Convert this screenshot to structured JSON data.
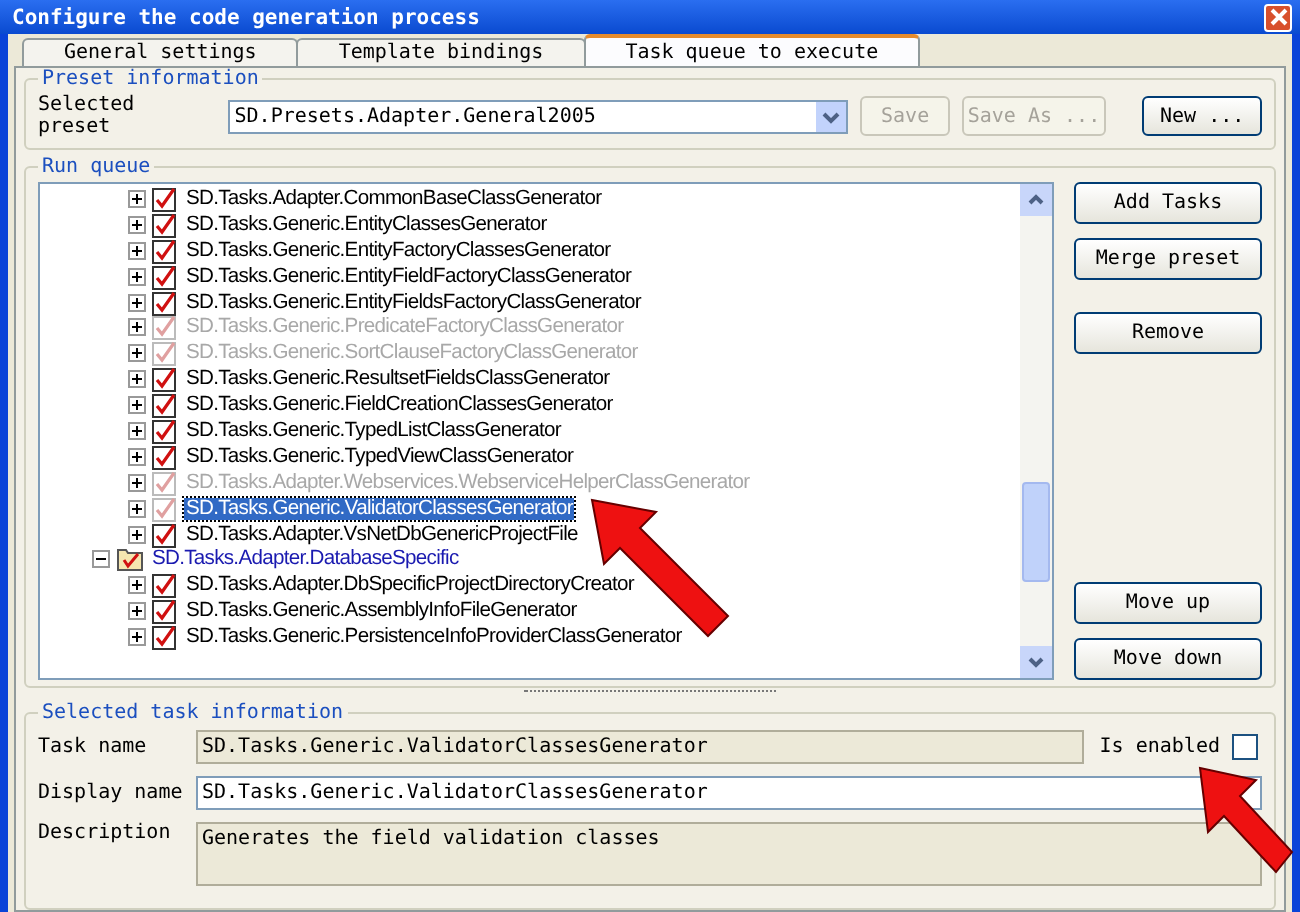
{
  "window": {
    "title": "Configure the code generation process"
  },
  "tabs": [
    {
      "label": "General settings",
      "selected": false
    },
    {
      "label": "Template bindings",
      "selected": false
    },
    {
      "label": "Task queue to execute",
      "selected": true
    }
  ],
  "preset": {
    "legend": "Preset information",
    "label": "Selected preset",
    "value": "SD.Presets.Adapter.General2005",
    "buttons": [
      {
        "label": "Save",
        "disabled": true
      },
      {
        "label": "Save As ...",
        "disabled": true
      },
      {
        "label": "New ...",
        "disabled": false
      }
    ]
  },
  "run_queue": {
    "legend": "Run queue",
    "tree": [
      {
        "kind": "task",
        "label": "SD.Tasks.Adapter.CommonBaseClassGenerator",
        "enabled": true,
        "selected": false
      },
      {
        "kind": "task",
        "label": "SD.Tasks.Generic.EntityClassesGenerator",
        "enabled": true,
        "selected": false
      },
      {
        "kind": "task",
        "label": "SD.Tasks.Generic.EntityFactoryClassesGenerator",
        "enabled": true,
        "selected": false
      },
      {
        "kind": "task",
        "label": "SD.Tasks.Generic.EntityFieldFactoryClassGenerator",
        "enabled": true,
        "selected": false
      },
      {
        "kind": "task",
        "label": "SD.Tasks.Generic.EntityFieldsFactoryClassGenerator",
        "enabled": true,
        "selected": false
      },
      {
        "kind": "task",
        "label": "SD.Tasks.Generic.PredicateFactoryClassGenerator",
        "enabled": false,
        "selected": false
      },
      {
        "kind": "task",
        "label": "SD.Tasks.Generic.SortClauseFactoryClassGenerator",
        "enabled": false,
        "selected": false
      },
      {
        "kind": "task",
        "label": "SD.Tasks.Generic.ResultsetFieldsClassGenerator",
        "enabled": true,
        "selected": false
      },
      {
        "kind": "task",
        "label": "SD.Tasks.Generic.FieldCreationClassesGenerator",
        "enabled": true,
        "selected": false
      },
      {
        "kind": "task",
        "label": "SD.Tasks.Generic.TypedListClassGenerator",
        "enabled": true,
        "selected": false
      },
      {
        "kind": "task",
        "label": "SD.Tasks.Generic.TypedViewClassGenerator",
        "enabled": true,
        "selected": false
      },
      {
        "kind": "task",
        "label": "SD.Tasks.Adapter.Webservices.WebserviceHelperClassGenerator",
        "enabled": false,
        "selected": false
      },
      {
        "kind": "task",
        "label": "SD.Tasks.Generic.ValidatorClassesGenerator",
        "enabled": false,
        "selected": true
      },
      {
        "kind": "task",
        "label": "SD.Tasks.Adapter.VsNetDbGenericProjectFile",
        "enabled": true,
        "selected": false
      },
      {
        "kind": "group",
        "label": "SD.Tasks.Adapter.DatabaseSpecific",
        "expanded": true,
        "children": [
          {
            "kind": "task",
            "label": "SD.Tasks.Adapter.DbSpecificProjectDirectoryCreator",
            "enabled": true,
            "selected": false
          },
          {
            "kind": "task",
            "label": "SD.Tasks.Generic.AssemblyInfoFileGenerator",
            "enabled": true,
            "selected": false
          },
          {
            "kind": "task",
            "label": "SD.Tasks.Generic.PersistenceInfoProviderClassGenerator",
            "enabled": true,
            "selected": false
          }
        ]
      }
    ],
    "buttons": [
      "Add Tasks",
      "Merge preset",
      "Remove",
      "Move up",
      "Move down"
    ]
  },
  "task_info": {
    "legend": "Selected task information",
    "task_name_label": "Task name",
    "task_name": "SD.Tasks.Generic.ValidatorClassesGenerator",
    "enabled_label": "Is enabled",
    "enabled": false,
    "display_name_label": "Display name",
    "display_name": "SD.Tasks.Generic.ValidatorClassesGenerator",
    "description_label": "Description",
    "description": "Generates the field validation classes"
  }
}
